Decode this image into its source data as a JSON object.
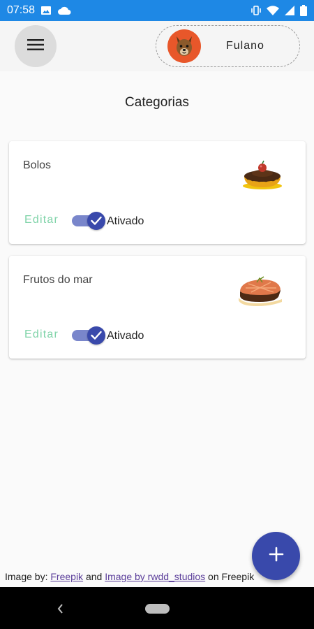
{
  "status_bar": {
    "time": "07:58",
    "icons": [
      "image-icon",
      "cloud-icon",
      "vibrate-icon",
      "wifi-icon",
      "signal-icon",
      "battery-icon"
    ]
  },
  "header": {
    "menu_icon": "hamburger-menu-icon",
    "profile": {
      "name": "Fulano",
      "avatar": "dog-avatar"
    }
  },
  "page": {
    "title": "Categorias"
  },
  "categories": [
    {
      "name": "Bolos",
      "edit_label": "Editar",
      "status_label": "Ativado",
      "enabled": true,
      "image": "cake-illustration"
    },
    {
      "name": "Frutos do mar",
      "edit_label": "Editar",
      "status_label": "Ativado",
      "enabled": true,
      "image": "fish-steak-illustration"
    }
  ],
  "fab": {
    "icon": "plus-icon"
  },
  "credits": {
    "prefix": "Image by: ",
    "link1": "Freepik",
    "middle": " and ",
    "link2": "Image by rwdd_studios",
    "suffix": " on Freepik"
  },
  "colors": {
    "status_bar": "#1e88e5",
    "accent": "#3949ab",
    "toggle_track": "#7986cb",
    "edit_text": "#7fd3a8",
    "avatar_bg": "#e8572a"
  }
}
